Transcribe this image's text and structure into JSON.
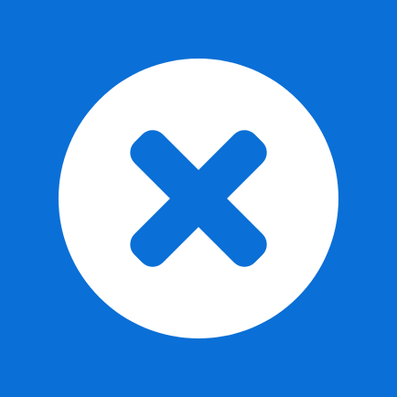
{
  "app_icon": {
    "name": "close-x-icon",
    "background_color": "#0A6FD6",
    "circle_color": "#FFFFFF",
    "glyph_color": "#0A6FD6"
  }
}
